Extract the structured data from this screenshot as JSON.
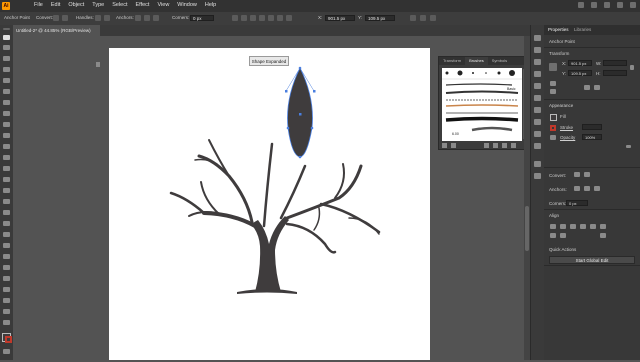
{
  "app": {
    "logo_text": "Ai"
  },
  "menu": [
    "File",
    "Edit",
    "Object",
    "Type",
    "Select",
    "Effect",
    "View",
    "Window",
    "Help"
  ],
  "control_bar": {
    "selection_label": "Anchor Point",
    "convert_label": "Convert:",
    "handles_label": "Handles:",
    "anchors_label": "Anchors:",
    "corners_label": "Corners:",
    "corners_value": "0 px",
    "x_label": "X:",
    "x_value": "901.5 px",
    "y_label": "Y:",
    "y_value": "109.5 px"
  },
  "document_tab": {
    "title": "Untitled-2* @ 44.85% (RGB/Preview)"
  },
  "tooltip": {
    "text": "Shape Expanded"
  },
  "brushes_panel": {
    "tabs": [
      "Transform",
      "Brushes",
      "Symbols"
    ],
    "basic_label": "Basic",
    "size_value": "6.00"
  },
  "properties_panel": {
    "tabs": [
      "Properties",
      "Libraries"
    ],
    "selection_type": "Anchor Point",
    "transform": {
      "heading": "Transform",
      "x_label": "X:",
      "x_value": "901.5 px",
      "y_label": "Y:",
      "y_value": "109.5 px",
      "w_label": "W:",
      "w_value": "",
      "h_label": "H:",
      "h_value": ""
    },
    "appearance": {
      "heading": "Appearance",
      "fill_label": "Fill",
      "stroke_label": "Stroke",
      "opacity_label": "Opacity",
      "opacity_value": "100%"
    },
    "convert": {
      "heading": "Convert:"
    },
    "anchors": {
      "heading": "Anchors:"
    },
    "corners": {
      "label": "Corners:",
      "value": "0 px"
    },
    "align": {
      "heading": "Align"
    },
    "quick_actions": {
      "heading": "Quick Actions",
      "button": "Start Global Edit"
    }
  },
  "colors": {
    "artwork": "#3f3c3d",
    "selection": "#4a7fe0",
    "accent": "#ff9a00",
    "stroke_swatch": "#c0392b"
  }
}
